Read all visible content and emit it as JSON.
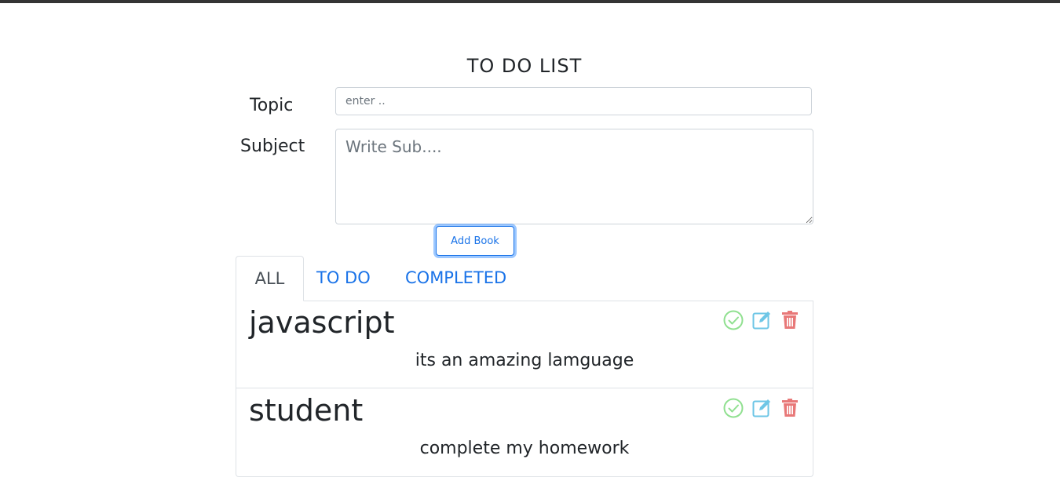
{
  "form": {
    "title": "TO DO LIST",
    "topic_label": "Topic",
    "topic_placeholder": "enter ..",
    "topic_value": "",
    "subject_label": "Subject",
    "subject_placeholder": "Write Sub....",
    "subject_value": "",
    "add_button_label": "Add Book"
  },
  "tabs": [
    {
      "label": "ALL",
      "active": true
    },
    {
      "label": "TO DO",
      "active": false
    },
    {
      "label": "COMPLETED",
      "active": false
    }
  ],
  "items": [
    {
      "title": "javascript",
      "subject": "its an amazing lamguage"
    },
    {
      "title": "student",
      "subject": "complete my homework"
    }
  ],
  "icons": {
    "complete": "check-circle-icon",
    "edit": "edit-icon",
    "delete": "trash-icon"
  },
  "colors": {
    "accent": "#1a73e8",
    "complete": "#90e090",
    "edit": "#6ec6e6",
    "delete": "#e87878"
  }
}
